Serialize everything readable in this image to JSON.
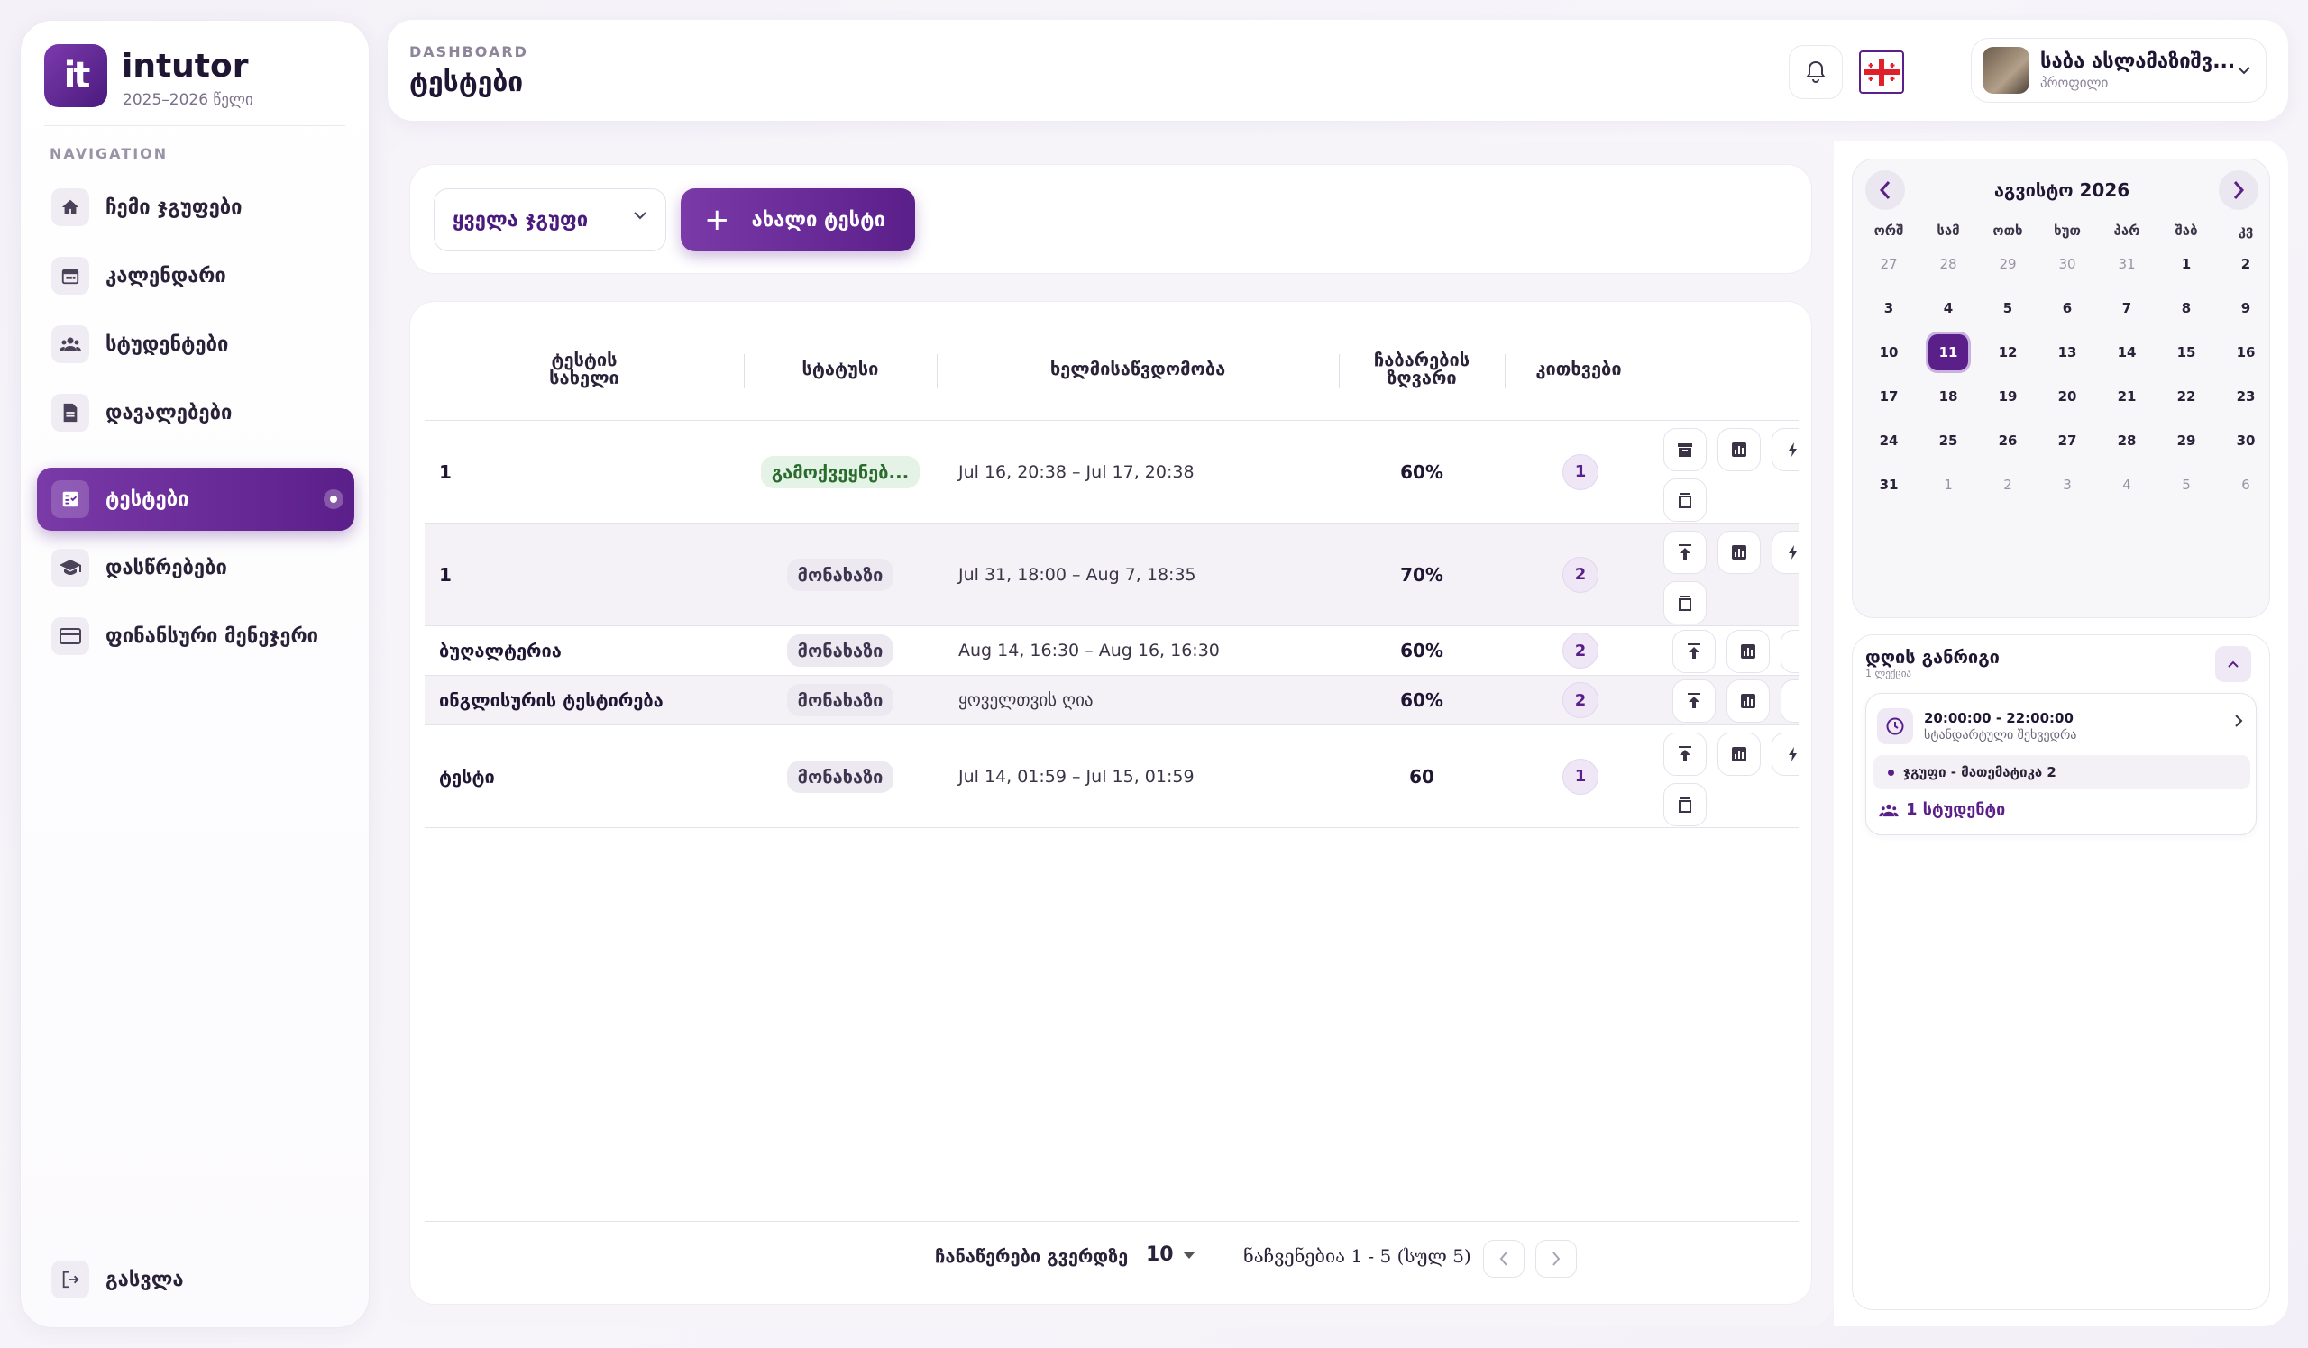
{
  "sidebar": {
    "logo_text": "it",
    "brand": "intutor",
    "year": "2025–2026 წელი",
    "nav_caption": "NAVIGATION",
    "items": [
      {
        "label": "ჩემი ჯგუფები",
        "icon": "home-icon"
      },
      {
        "label": "კალენდარი",
        "icon": "calendar-icon"
      },
      {
        "label": "სტუდენტები",
        "icon": "people-icon"
      },
      {
        "label": "დავალებები",
        "icon": "document-icon"
      },
      {
        "label": "ტესტები",
        "icon": "quiz-icon",
        "active": true
      },
      {
        "label": "დასწრებები",
        "icon": "school-icon"
      },
      {
        "label": "ფინანსური მენეჯერი",
        "icon": "card-icon"
      }
    ],
    "logout": "გასვლა"
  },
  "header": {
    "caption": "DASHBOARD",
    "title": "ტესტები",
    "profile": {
      "name": "საბა ასლამაზიშვ...",
      "sub": "პროფილი"
    }
  },
  "toolbar": {
    "group_select": "ყველა ჯგუფი",
    "new_button": "ახალი ტესტი"
  },
  "table": {
    "columns": [
      "ტესტის\nსახელი",
      "სტატუსი",
      "ხელმისაწვდომობა",
      "ჩაბარების\nზღვარი",
      "კითხვები"
    ],
    "rows": [
      {
        "name": "1",
        "status": "გამოქვეყნებ...",
        "status_type": "published",
        "availability": "Jul 16, 20:38 – Jul 17, 20:38",
        "threshold": "60%",
        "questions": "1"
      },
      {
        "name": "1",
        "status": "მონახაზი",
        "status_type": "draft",
        "availability": "Jul 31, 18:00 – Aug 7, 18:35",
        "threshold": "70%",
        "questions": "2"
      },
      {
        "name": "ბუღალტერია",
        "status": "მონახაზი",
        "status_type": "draft",
        "availability": "Aug 14, 16:30 – Aug 16, 16:30",
        "threshold": "60%",
        "questions": "2"
      },
      {
        "name": "ინგლისურის ტესტირება",
        "status": "მონახაზი",
        "status_type": "draft",
        "availability": "ყოველთვის ღია",
        "threshold": "60%",
        "questions": "2"
      },
      {
        "name": "ტესტი",
        "status": "მონახაზი",
        "status_type": "draft",
        "availability": "Jul 14, 01:59 – Jul 15, 01:59",
        "threshold": "60",
        "questions": "1"
      }
    ],
    "footer": {
      "rows_per_page_label": "ჩანაწერები გვერდზე",
      "rows_per_page": "10",
      "range": "ნაჩვენებია 1 - 5 (სულ 5)"
    }
  },
  "calendar": {
    "title": "აგვისტო 2026",
    "weekdays": [
      "ორშ",
      "სამ",
      "ოთხ",
      "ხუთ",
      "პარ",
      "შაბ",
      "კვ"
    ],
    "weeks": [
      [
        "27",
        "28",
        "29",
        "30",
        "31",
        "1",
        "2"
      ],
      [
        "3",
        "4",
        "5",
        "6",
        "7",
        "8",
        "9"
      ],
      [
        "10",
        "11",
        "12",
        "13",
        "14",
        "15",
        "16"
      ],
      [
        "17",
        "18",
        "19",
        "20",
        "21",
        "22",
        "23"
      ],
      [
        "24",
        "25",
        "26",
        "27",
        "28",
        "29",
        "30"
      ],
      [
        "31",
        "1",
        "2",
        "3",
        "4",
        "5",
        "6"
      ]
    ],
    "selected": "11"
  },
  "day_overview": {
    "title": "დღის განრიგი",
    "subtitle": "1 ლექცია",
    "event": {
      "time": "20:00:00 - 22:00:00",
      "type": "სტანდარტული შეხვედრა",
      "group": "ჯგუფი - მათემატიკა 2",
      "students": "1 სტუდენტი"
    }
  },
  "colors": {
    "accent": "#5b1f8a",
    "published_chip": "#e5f3e6",
    "draft_chip": "#ece9f0"
  }
}
